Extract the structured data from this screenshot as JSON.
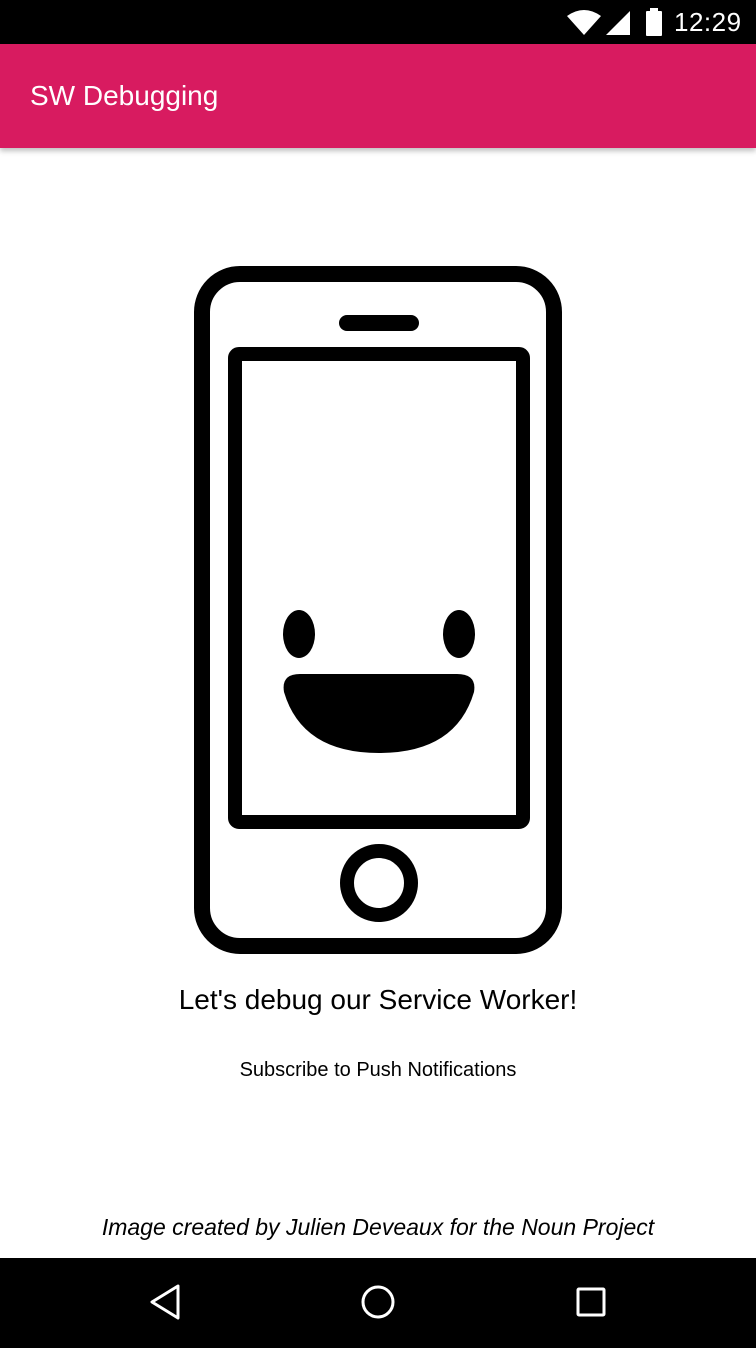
{
  "status_bar": {
    "time": "12:29",
    "icons": [
      "wifi-icon",
      "cell-signal-icon",
      "battery-icon"
    ]
  },
  "app_bar": {
    "title": "SW Debugging",
    "color": "#d81b60"
  },
  "main": {
    "illustration": "smiling-phone-icon",
    "headline": "Let's debug our Service Worker!",
    "subscribe_label": "Subscribe to Push Notifications",
    "credit": "Image created by Julien Deveaux for the Noun Project"
  },
  "nav_bar": {
    "buttons": [
      "back-icon",
      "home-icon",
      "recents-icon"
    ]
  }
}
